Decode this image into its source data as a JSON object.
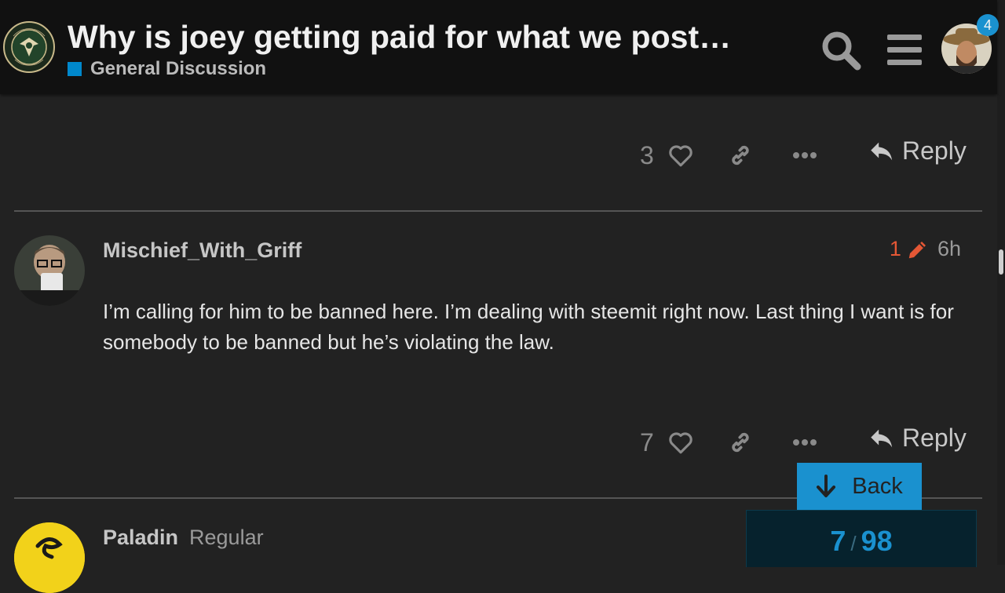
{
  "header": {
    "title": "Why is joey getting paid for what we post…",
    "category": "General Discussion",
    "category_color": "#0088cc",
    "logo_text": "INFOWARS ARMY",
    "notification_count": "4",
    "icons": [
      "search-icon",
      "hamburger-menu-icon",
      "user-avatar"
    ]
  },
  "prev_post": {
    "like_count": "3",
    "reply_label": "Reply"
  },
  "post": {
    "username": "Mischief_With_Griff",
    "edit_count": "1",
    "age": "6h",
    "body": "I’m calling for him to be banned here. I’m dealing with steemit right now. Last thing I want is for somebody to be banned but he’s violating the law.",
    "like_count": "7",
    "reply_label": "Reply"
  },
  "next_post": {
    "username": "Paladin",
    "user_title": "Regular"
  },
  "timeline": {
    "back_label": "Back",
    "current": "7",
    "separator": "/",
    "total": "98"
  },
  "colors": {
    "background": "#222222",
    "header": "#111111",
    "accent": "#1a91cf",
    "edit": "#e45735"
  }
}
